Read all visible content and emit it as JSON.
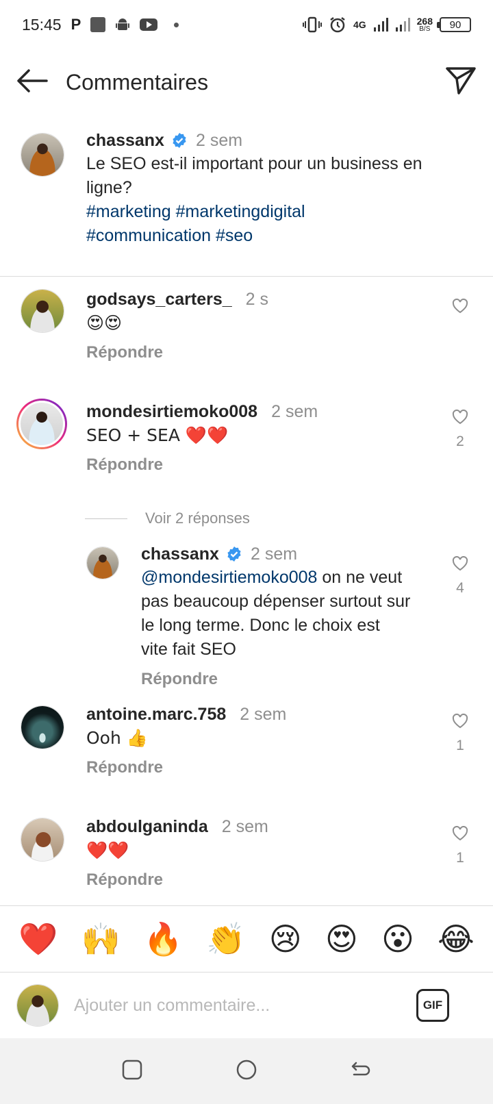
{
  "status_bar": {
    "time": "15:45",
    "network": "4G",
    "speed_value": "268",
    "speed_unit": "B/S",
    "battery": "90"
  },
  "header": {
    "title": "Commentaires"
  },
  "caption": {
    "username": "chassanx",
    "time": "2 sem",
    "text": "Le SEO est-il important pour un business en ligne?",
    "hashtags_line1": "#marketing #marketingdigital",
    "hashtags_line2": "#communication #seo"
  },
  "comments": [
    {
      "username": "godsays_carters_",
      "time": "2 s",
      "text": "😍😍",
      "reply": "Répondre",
      "likes": ""
    },
    {
      "username": "mondesirtiemoko008",
      "time": "2 sem",
      "text": "SEO + SEA ❤️❤️",
      "reply": "Répondre",
      "likes": "2"
    },
    {
      "username": "antoine.marc.758",
      "time": "2 sem",
      "text": "Ooh 👍",
      "reply": "Répondre",
      "likes": "1"
    },
    {
      "username": "abdoulganinda",
      "time": "2 sem",
      "text": "❤️❤️",
      "reply": "Répondre",
      "likes": "1"
    }
  ],
  "view_replies": "Voir 2 réponses",
  "reply": {
    "username": "chassanx",
    "time": "2 sem",
    "mention": "@mondesirtiemoko008",
    "text_line1": " on ne veut",
    "text_line2": "pas beaucoup dépenser surtout sur",
    "text_line3": "le long terme. Donc le choix est",
    "text_line4": "vite fait SEO",
    "reply": "Répondre",
    "likes": "4"
  },
  "emoji_bar": [
    "❤️",
    "🙌",
    "🔥",
    "👏",
    "😢",
    "😍",
    "😮",
    "😂"
  ],
  "input": {
    "placeholder": "Ajouter un commentaire...",
    "gif_label": "GIF"
  },
  "colors": {
    "link": "#00376b",
    "secondary": "#8e8e8e",
    "verified": "#3897f0"
  }
}
